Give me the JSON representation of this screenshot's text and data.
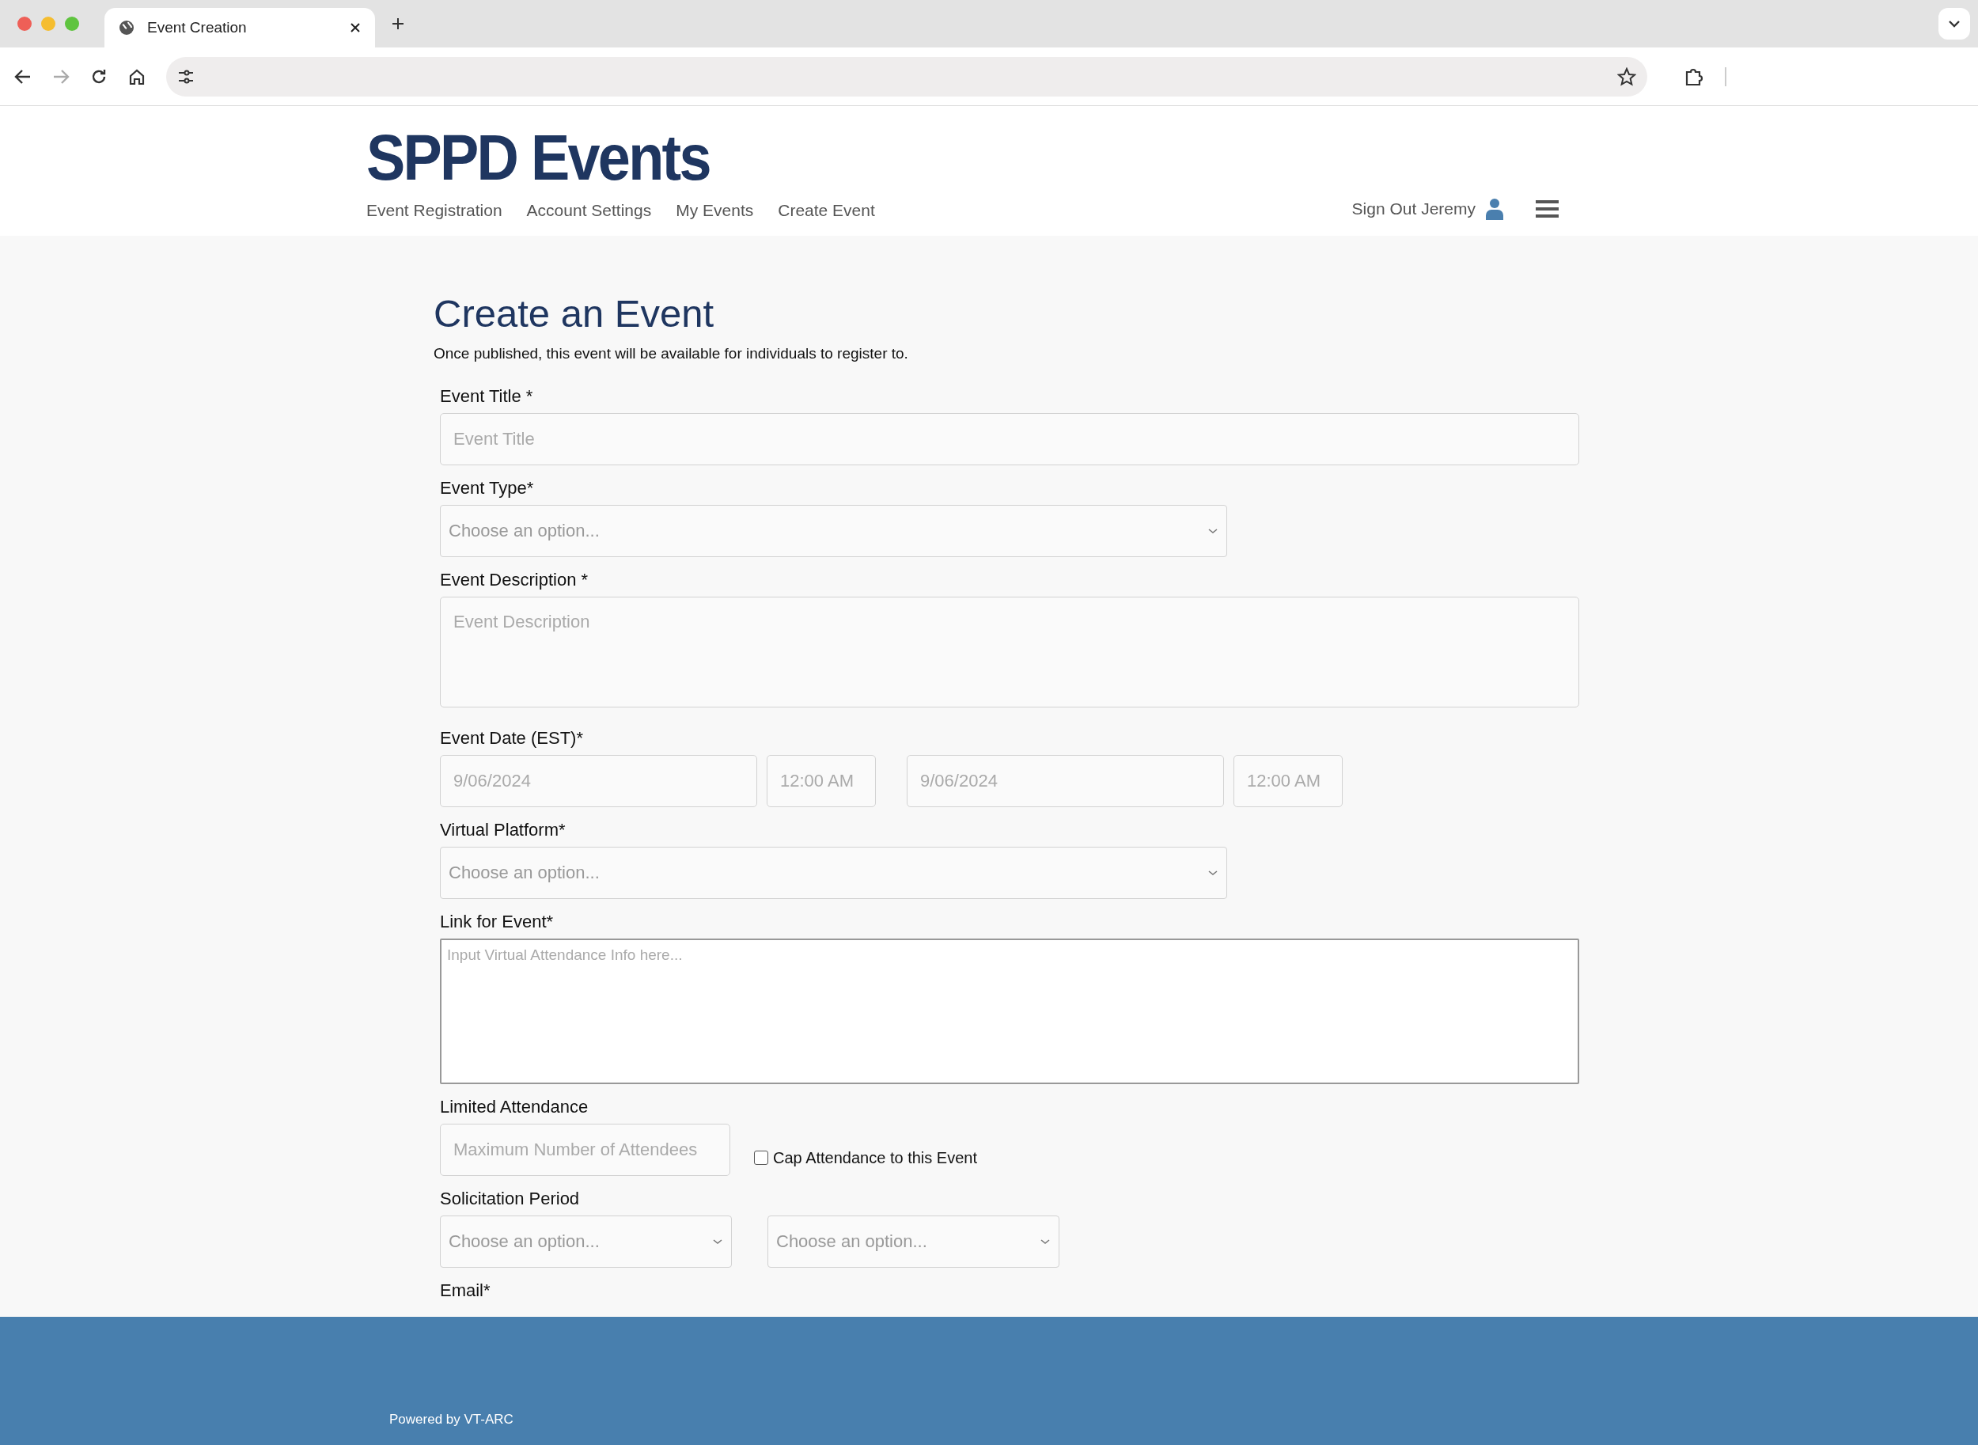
{
  "browser": {
    "tab_title": "Event Creation"
  },
  "header": {
    "logo": "SPPD Events",
    "nav": [
      {
        "label": "Event Registration"
      },
      {
        "label": "Account Settings"
      },
      {
        "label": "My Events"
      },
      {
        "label": "Create Event"
      }
    ],
    "user_link": "Sign Out Jeremy"
  },
  "form": {
    "title": "Create an Event",
    "subtitle": "Once published, this event will be available for individuals to register to.",
    "groups": [
      {
        "kind": "text",
        "label": "Event Title *",
        "placeholder": "Event Title"
      },
      {
        "kind": "select",
        "label": "Event Type*",
        "placeholder": "Choose an option..."
      },
      {
        "kind": "textarea",
        "label": "Event Description *",
        "placeholder": "Event Description"
      },
      {
        "kind": "daterange",
        "label": "Event Date (EST)*",
        "placeholders": [
          "9/06/2024",
          "12:00 AM",
          "9/06/2024",
          "12:00 AM"
        ]
      },
      {
        "kind": "select",
        "label": "Virtual Platform*",
        "placeholder": "Choose an option..."
      },
      {
        "kind": "bigtext",
        "label": "Link for Event*",
        "placeholder": "Input Virtual Attendance Info here..."
      },
      {
        "kind": "attendance",
        "label": "Limited Attendance",
        "placeholder": "Maximum Number of Attendees",
        "checkbox": {
          "label": "Cap Attendance to this Event",
          "checked": false
        }
      },
      {
        "kind": "selectpair",
        "label": "Solicitation Period",
        "placeholders": [
          "Choose an option...",
          "Choose an option..."
        ]
      },
      {
        "kind": "heading",
        "label": "Email*"
      }
    ]
  },
  "footer": {
    "text": "Powered by VT-ARC"
  }
}
